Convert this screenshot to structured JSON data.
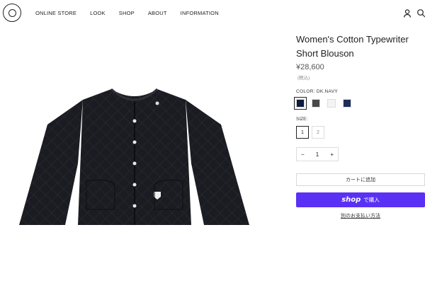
{
  "header": {
    "nav": [
      "ONLINE STORE",
      "LOOK",
      "SHOP",
      "ABOUT",
      "INFORMATION"
    ],
    "icons": [
      "account-icon",
      "search-icon"
    ]
  },
  "product": {
    "title": "Women's Cotton Typewriter Short Blouson",
    "price": "¥28,600",
    "tax_note": "(税込)",
    "color_label": "COLOR: DK.NAVY",
    "colors": [
      "#0f1b3d",
      "#4a4848",
      "#f4f4f4",
      "#1f2c5a"
    ],
    "size_label": "SIZE:",
    "sizes": [
      "1",
      "2"
    ],
    "quantity": "1",
    "add_to_cart": "カートに追加",
    "shop_pay_brand": "shop",
    "shop_pay_label": "で購入",
    "other_payment": "別のお支払い方法"
  }
}
